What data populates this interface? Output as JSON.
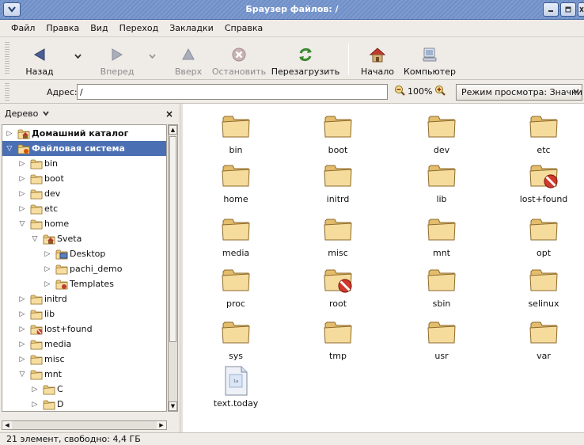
{
  "window": {
    "title": "Браузер файлов: /",
    "controls": [
      "minimize",
      "maximize",
      "close"
    ]
  },
  "menu": [
    {
      "label": "Файл"
    },
    {
      "label": "Правка"
    },
    {
      "label": "Вид"
    },
    {
      "label": "Переход"
    },
    {
      "label": "Закладки"
    },
    {
      "label": "Справка"
    }
  ],
  "toolbar": {
    "back": "Назад",
    "forward": "Вперед",
    "up": "Вверх",
    "stop": "Остановить",
    "reload": "Перезагрузить",
    "home": "Начало",
    "computer": "Компьютер"
  },
  "address": {
    "label": "Адрес:",
    "value": "/",
    "zoom": "100%",
    "view_mode": "Режим просмотра: Значки"
  },
  "sidebar": {
    "title": "Дерево",
    "close": "×",
    "tree": [
      {
        "label": "Домашний каталог",
        "expander": "▷",
        "level": 0,
        "bold": true,
        "icon": "home-folder-icon"
      },
      {
        "label": "Файловая система",
        "expander": "▽",
        "level": 0,
        "selected": true,
        "icon": "root-folder-icon"
      },
      {
        "label": "bin",
        "expander": "▷",
        "level": 1,
        "icon": "folder-icon"
      },
      {
        "label": "boot",
        "expander": "▷",
        "level": 1,
        "icon": "folder-icon"
      },
      {
        "label": "dev",
        "expander": "▷",
        "level": 1,
        "icon": "folder-icon"
      },
      {
        "label": "etc",
        "expander": "▷",
        "level": 1,
        "icon": "folder-icon"
      },
      {
        "label": "home",
        "expander": "▽",
        "level": 1,
        "icon": "folder-icon"
      },
      {
        "label": "Sveta",
        "expander": "▽",
        "level": 2,
        "icon": "home-folder-icon"
      },
      {
        "label": "Desktop",
        "expander": "▷",
        "level": 3,
        "icon": "desktop-folder-icon"
      },
      {
        "label": "pachi_demo",
        "expander": "▷",
        "level": 3,
        "icon": "folder-icon"
      },
      {
        "label": "Templates",
        "expander": "▷",
        "level": 3,
        "icon": "templates-folder-icon"
      },
      {
        "label": "initrd",
        "expander": "▷",
        "level": 1,
        "icon": "folder-icon"
      },
      {
        "label": "lib",
        "expander": "▷",
        "level": 1,
        "icon": "folder-icon"
      },
      {
        "label": "lost+found",
        "expander": "▷",
        "level": 1,
        "icon": "locked-folder-icon"
      },
      {
        "label": "media",
        "expander": "▷",
        "level": 1,
        "icon": "folder-icon"
      },
      {
        "label": "misc",
        "expander": "▷",
        "level": 1,
        "icon": "folder-icon"
      },
      {
        "label": "mnt",
        "expander": "▽",
        "level": 1,
        "icon": "folder-icon"
      },
      {
        "label": "C",
        "expander": "▷",
        "level": 2,
        "icon": "folder-icon"
      },
      {
        "label": "D",
        "expander": "▷",
        "level": 2,
        "icon": "folder-icon"
      }
    ]
  },
  "files": [
    {
      "name": "bin",
      "type": "folder"
    },
    {
      "name": "boot",
      "type": "folder"
    },
    {
      "name": "dev",
      "type": "folder"
    },
    {
      "name": "etc",
      "type": "folder"
    },
    {
      "name": "home",
      "type": "folder"
    },
    {
      "name": "initrd",
      "type": "folder"
    },
    {
      "name": "lib",
      "type": "folder"
    },
    {
      "name": "lost+found",
      "type": "locked-folder"
    },
    {
      "name": "media",
      "type": "folder"
    },
    {
      "name": "misc",
      "type": "folder"
    },
    {
      "name": "mnt",
      "type": "folder"
    },
    {
      "name": "opt",
      "type": "folder"
    },
    {
      "name": "proc",
      "type": "folder"
    },
    {
      "name": "root",
      "type": "locked-folder"
    },
    {
      "name": "sbin",
      "type": "folder"
    },
    {
      "name": "selinux",
      "type": "folder"
    },
    {
      "name": "sys",
      "type": "folder"
    },
    {
      "name": "tmp",
      "type": "folder"
    },
    {
      "name": "usr",
      "type": "folder"
    },
    {
      "name": "var",
      "type": "folder"
    },
    {
      "name": "text.today",
      "type": "text-file",
      "thumb_text": "1a"
    }
  ],
  "status": "21 элемент, свободно: 4,4 ГБ",
  "colors": {
    "selection": "#4b6fb3",
    "folder": "#f2d58c",
    "titlebar": "#7d9bd0"
  }
}
